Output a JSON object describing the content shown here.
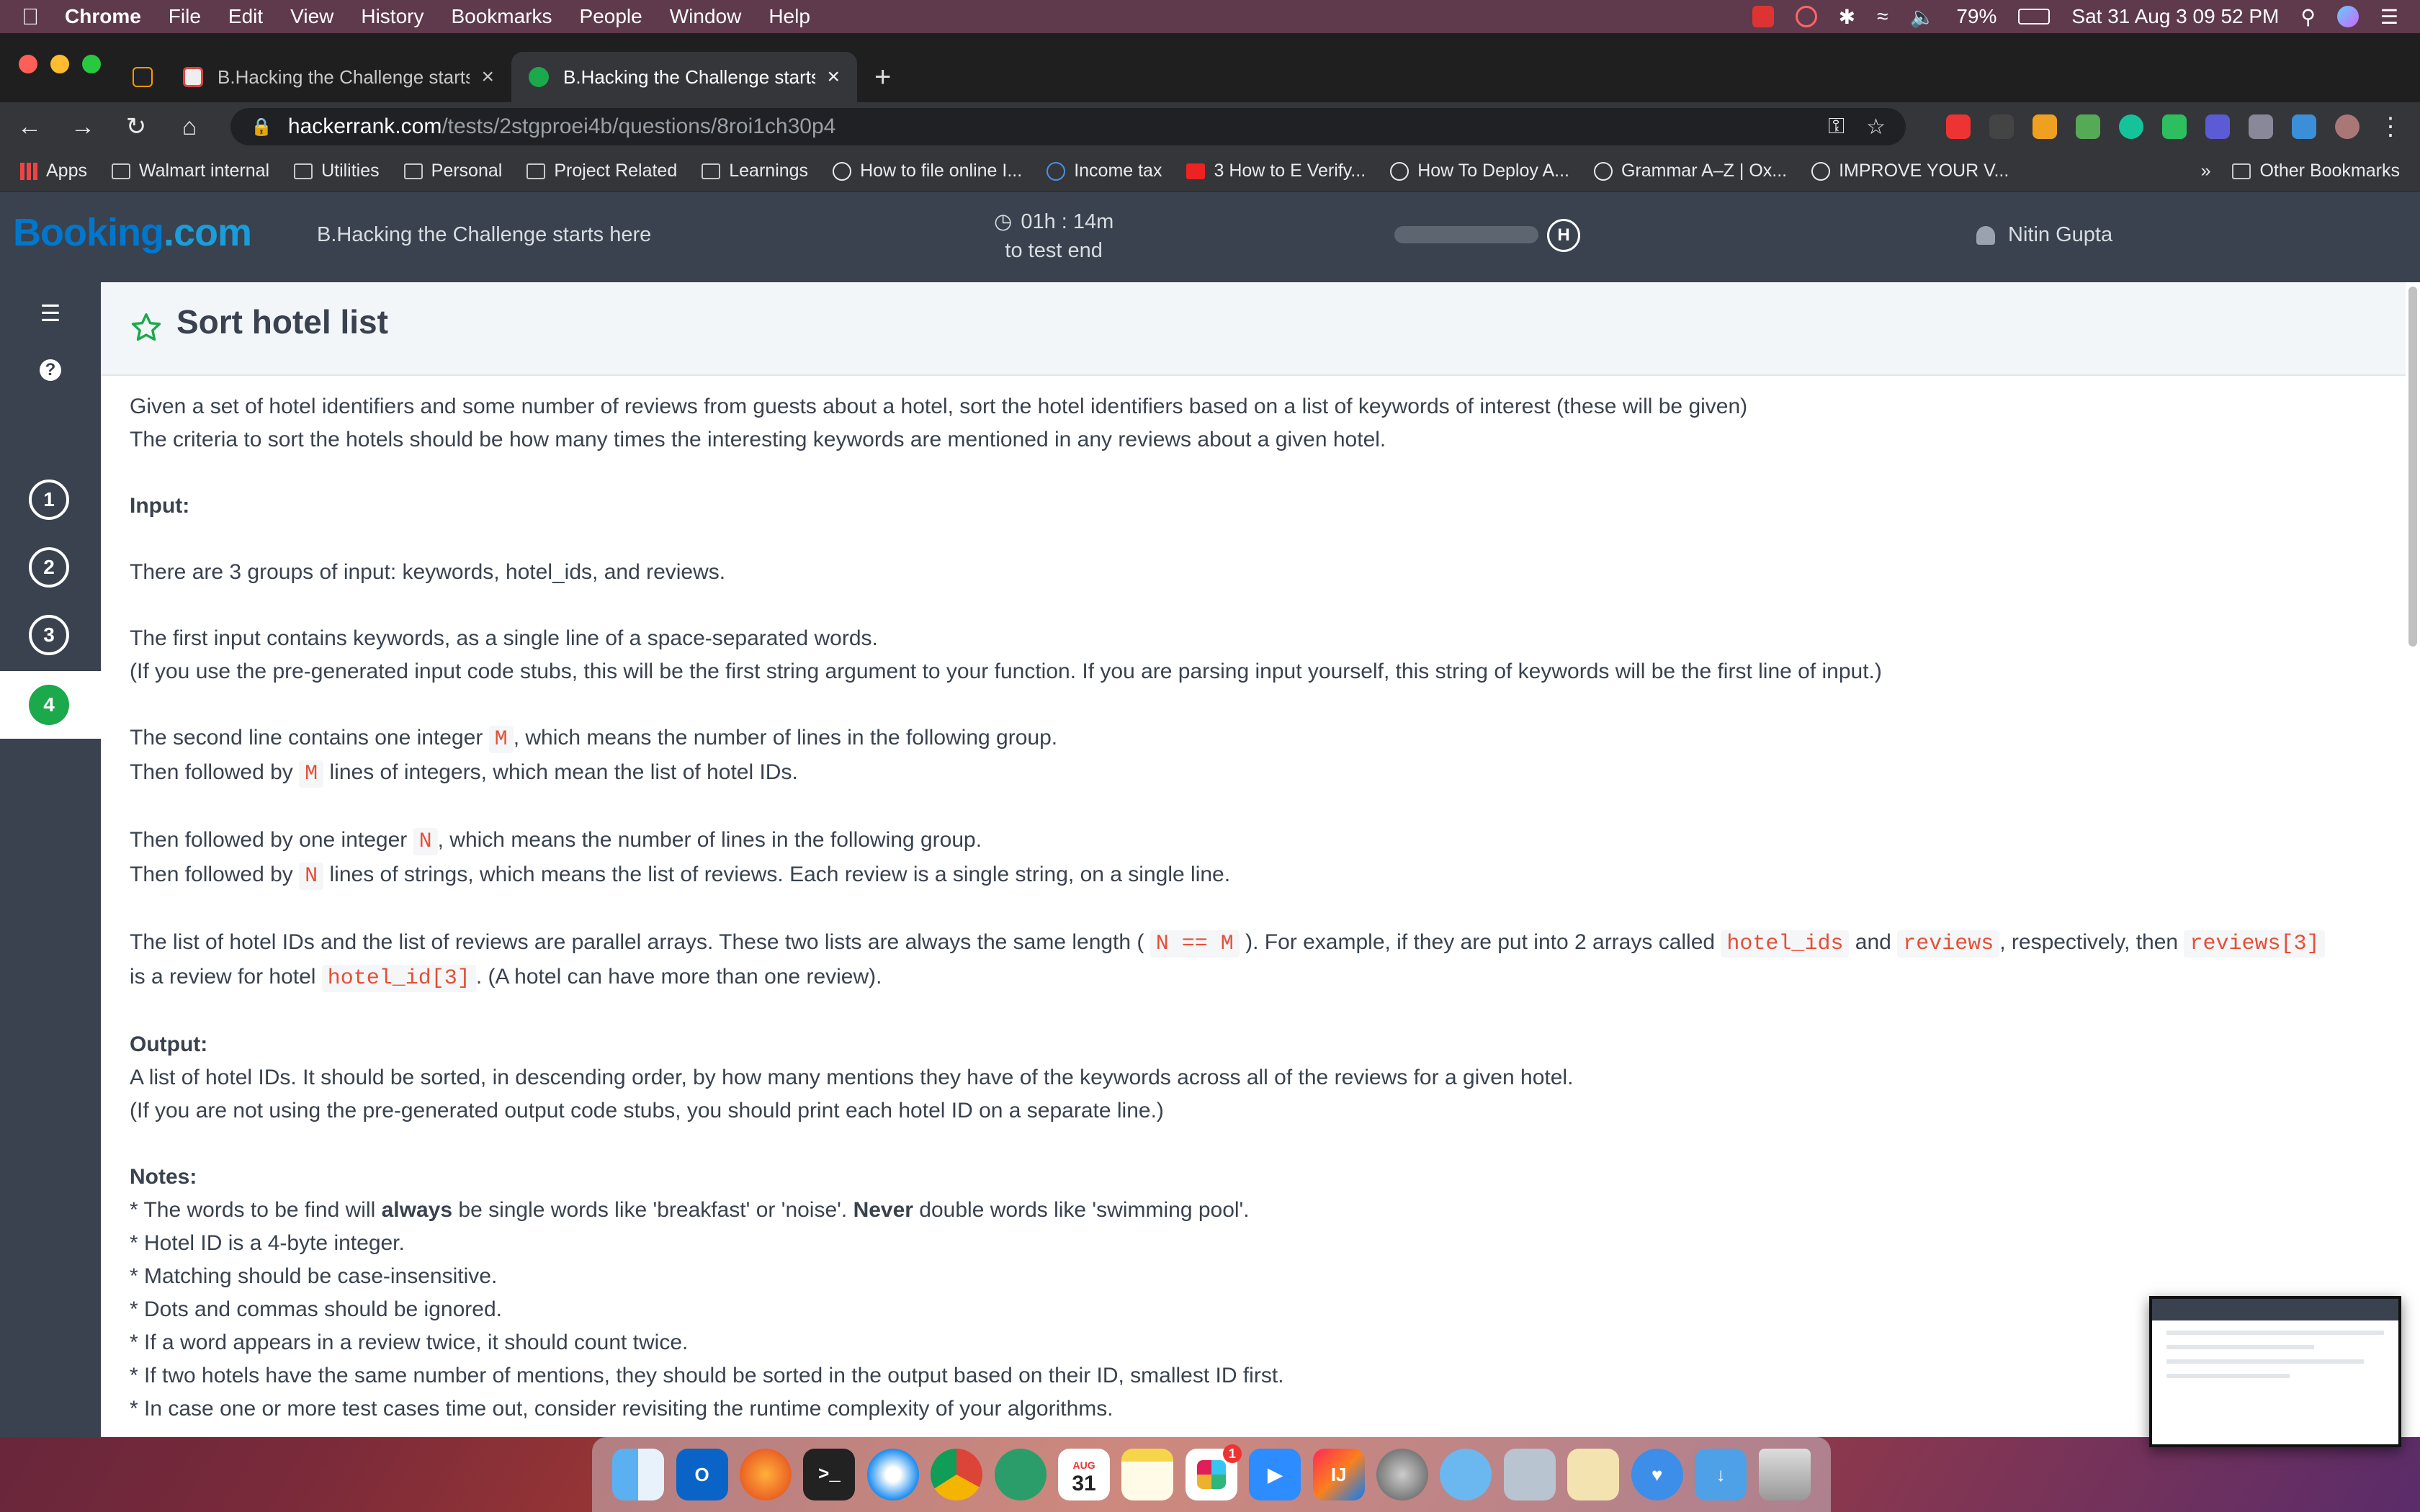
{
  "menubar": {
    "app": "Chrome",
    "menus": [
      "File",
      "Edit",
      "View",
      "History",
      "Bookmarks",
      "People",
      "Window",
      "Help"
    ],
    "battery": "79%",
    "datetime": "Sat 31 Aug  3 09 52 PM"
  },
  "tabs": [
    {
      "title": "B.Hacking the Challenge starts here",
      "active": false
    },
    {
      "title": "B.Hacking the Challenge starts here",
      "active": true
    }
  ],
  "address": {
    "host": "hackerrank.com",
    "path": "/tests/2stgproei4b/questions/8roi1ch30p4"
  },
  "bookmarks": {
    "items": [
      "Apps",
      "Walmart internal",
      "Utilities",
      "Personal",
      "Project Related",
      "Learnings",
      "How to file online I...",
      "Income tax",
      "3 How to E Verify...",
      "How To Deploy A...",
      "Grammar A–Z | Ox...",
      "IMPROVE YOUR V..."
    ],
    "overflow": "»",
    "other": "Other Bookmarks"
  },
  "header": {
    "logo_main": "Booking",
    "logo_dot": ".com",
    "test_title": "B.Hacking the Challenge starts here",
    "timer": "01h : 14m",
    "timer_sub": "to test end",
    "badge": "H",
    "user": "Nitin Gupta"
  },
  "sidebar": {
    "questions": [
      "1",
      "2",
      "3",
      "4"
    ],
    "active_question": "4"
  },
  "question": {
    "title": "Sort hotel list",
    "intro1": "Given a set of hotel identifiers and some number of reviews from guests about a hotel, sort the hotel identifiers based on a list of keywords of interest (these will be given)",
    "intro2": "The criteria to sort the hotels should be how many times the interesting keywords are mentioned in any reviews about a given hotel.",
    "input_heading": "Input:",
    "input1": "There are 3 groups of input: keywords, hotel_ids, and reviews.",
    "input2": "The first input contains keywords, as a single line of a space-separated words.",
    "input3": "(If you use the pre-generated input code stubs, this will be the first string argument to your function. If you are parsing input yourself, this string of keywords will be the first line of input.)",
    "m_line_a": "The second line contains one integer ",
    "m_code": "M",
    "m_line_b": ", which means the number of lines in the following group.",
    "m2_a": "Then followed by ",
    "m2_b": " lines of integers, which mean the list of hotel IDs.",
    "n_line_a": "Then followed by one integer ",
    "n_code": "N",
    "n_line_b": ", which means the number of lines in the following group.",
    "n2_a": "Then followed by ",
    "n2_b": " lines of strings, which means the list of reviews. Each review is a single string, on a single line.",
    "par_a": "The list of hotel IDs and the list of reviews are parallel arrays. These two lists are always the same length ( ",
    "par_code1": "N == M",
    "par_b": " ). For example, if they are put into 2 arrays called ",
    "par_code2": "hotel_ids",
    "par_c": " and ",
    "par_code3": "reviews",
    "par_d": ", respectively, then ",
    "par_code4": "reviews[3]",
    "par2_a": "is a review for hotel ",
    "par2_code": "hotel_id[3]",
    "par2_b": ". (A hotel can have more than one review).",
    "output_heading": "Output:",
    "output1": "A list of hotel IDs. It should be sorted, in descending order, by how many mentions they have of the keywords across all of the reviews for a given hotel.",
    "output2": "(If you are not using the pre-generated output code stubs, you should print each hotel ID on a separate line.)",
    "notes_heading": "Notes:",
    "note1_a": "* The words to be find will ",
    "note1_b1": "always",
    "note1_c": " be single words like 'breakfast' or 'noise'. ",
    "note1_b2": "Never",
    "note1_d": " double words like 'swimming pool'.",
    "note2": "* Hotel ID is a 4-byte integer.",
    "note3": "* Matching should be case-insensitive.",
    "note4": "* Dots and commas should be ignored.",
    "note5": "* If a word appears in a review twice, it should count twice.",
    "note6": "* If two hotels have the same number of mentions, they should be sorted in the output based on their ID, smallest ID first.",
    "note7": "* In case one or more test cases time out, consider revisiting the runtime complexity of your algorithms."
  },
  "dock": {
    "calendar_month": "AUG",
    "calendar_day": "31",
    "slack_badge": "1"
  },
  "colors": {
    "header_bg": "#39424e",
    "accent_green": "#1ba94c",
    "code_red": "#e44f37",
    "booking_blue": "#0077cc"
  }
}
